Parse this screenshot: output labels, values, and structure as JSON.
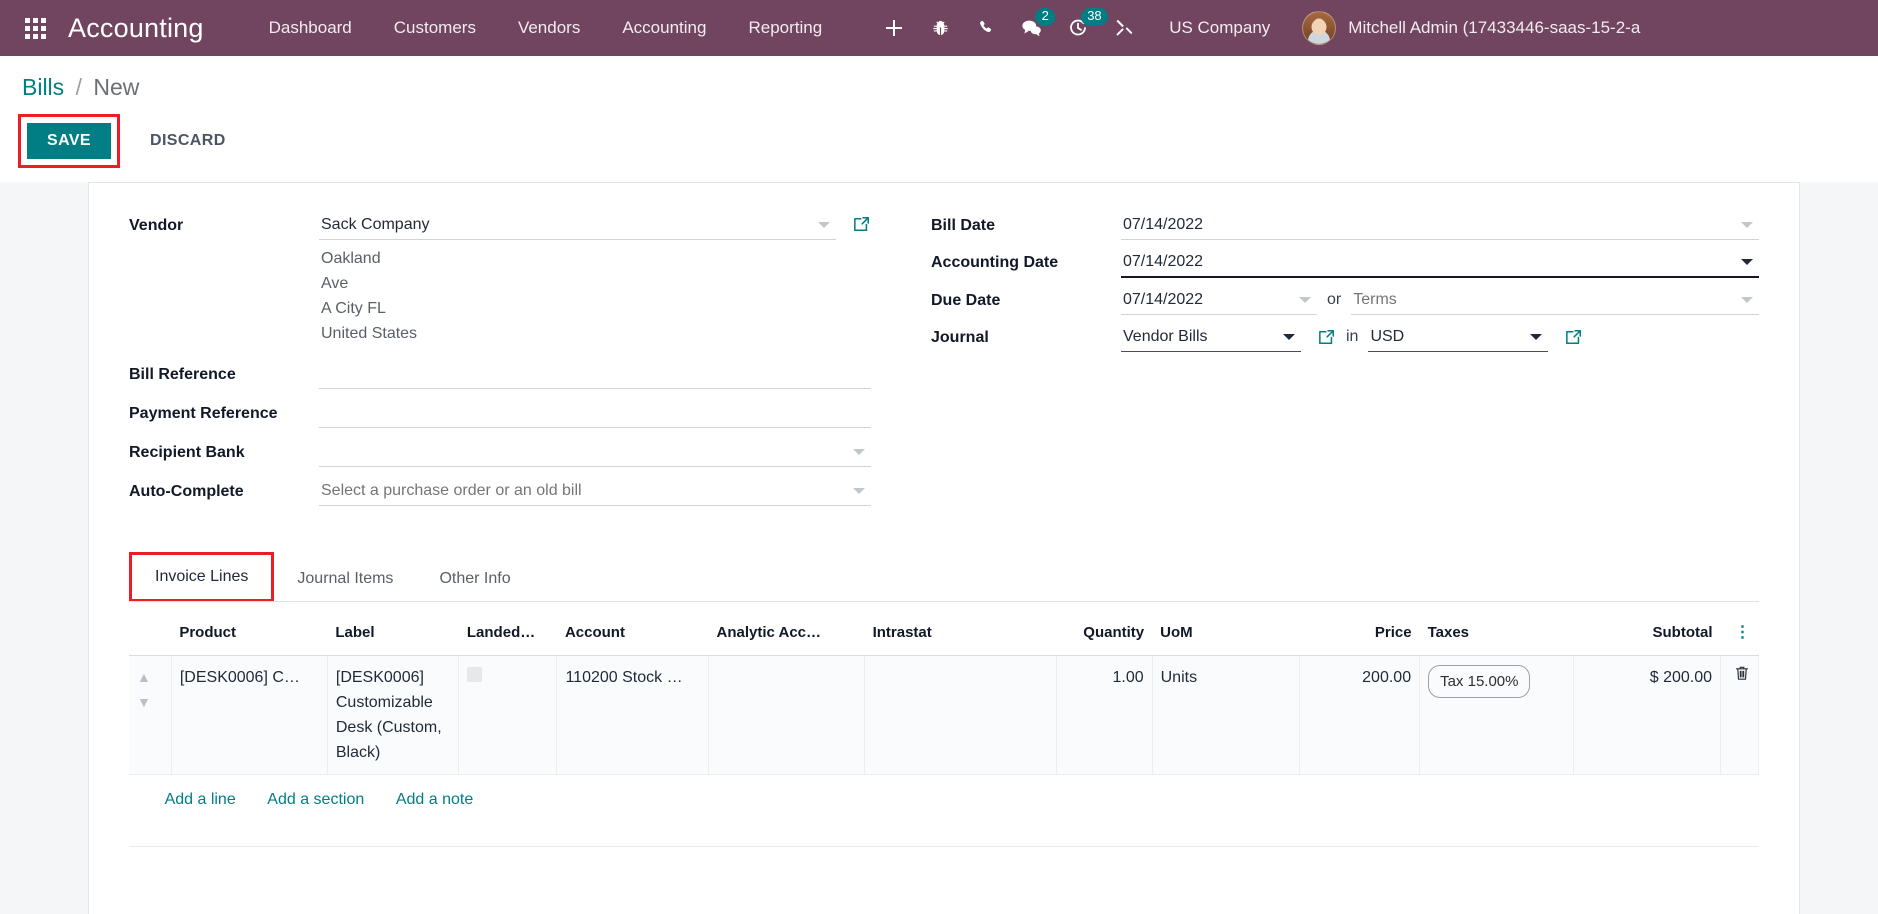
{
  "navbar": {
    "apps_icon": "apps-grid-icon",
    "brand": "Accounting",
    "menu": [
      {
        "label": "Dashboard"
      },
      {
        "label": "Customers"
      },
      {
        "label": "Vendors"
      },
      {
        "label": "Accounting"
      },
      {
        "label": "Reporting"
      }
    ],
    "icons": [
      {
        "name": "plus-icon",
        "badge": null
      },
      {
        "name": "bug-icon",
        "badge": null
      },
      {
        "name": "phone-icon",
        "badge": null
      },
      {
        "name": "messages-icon",
        "badge": "2"
      },
      {
        "name": "activity-clock-icon",
        "badge": "38"
      },
      {
        "name": "tools-icon",
        "badge": null
      }
    ],
    "messages_badge": "2",
    "activities_badge": "38",
    "company": "US Company",
    "user": "Mitchell Admin (17433446-saas-15-2-a",
    "brand_color": "#71445f",
    "accent_color": "#017e84"
  },
  "breadcrumb": {
    "root": "Bills",
    "separator": "/",
    "current": "New"
  },
  "actions": {
    "save": "SAVE",
    "discard": "DISCARD",
    "highlight_color": "#ee1c24"
  },
  "form": {
    "left": {
      "vendor_label": "Vendor",
      "vendor_value": "Sack Company",
      "vendor_address": [
        "Oakland",
        "Ave",
        "A City FL",
        "United States"
      ],
      "bill_reference_label": "Bill Reference",
      "bill_reference_value": "",
      "payment_reference_label": "Payment Reference",
      "payment_reference_value": "",
      "recipient_bank_label": "Recipient Bank",
      "recipient_bank_value": "",
      "autocomplete_label": "Auto-Complete",
      "autocomplete_placeholder": "Select a purchase order or an old bill"
    },
    "right": {
      "bill_date_label": "Bill Date",
      "bill_date_value": "07/14/2022",
      "accounting_date_label": "Accounting Date",
      "accounting_date_value": "07/14/2022",
      "due_date_label": "Due Date",
      "due_date_value": "07/14/2022",
      "or_word": "or",
      "terms_placeholder": "Terms",
      "journal_label": "Journal",
      "journal_value": "Vendor Bills",
      "in_word": "in",
      "currency_value": "USD"
    }
  },
  "tabs": [
    {
      "label": "Invoice Lines",
      "active": true,
      "highlighted": true
    },
    {
      "label": "Journal Items",
      "active": false,
      "highlighted": false
    },
    {
      "label": "Other Info",
      "active": false,
      "highlighted": false
    }
  ],
  "lines_table": {
    "headers": {
      "product": "Product",
      "label": "Label",
      "landed": "Landed…",
      "account": "Account",
      "analytic": "Analytic Acc…",
      "intrastat": "Intrastat",
      "quantity": "Quantity",
      "uom": "UoM",
      "price": "Price",
      "taxes": "Taxes",
      "subtotal": "Subtotal",
      "options": "options-icon"
    },
    "rows": [
      {
        "product": "[DESK0006] C…",
        "label": "[DESK0006] Customizable Desk (Custom, Black)",
        "landed": "",
        "account": "110200 Stock …",
        "analytic": "",
        "intrastat": "",
        "quantity": "1.00",
        "uom": "Units",
        "price": "200.00",
        "taxes": "Tax 15.00%",
        "subtotal": "$ 200.00",
        "delete_icon": "trash-icon"
      }
    ],
    "add_links": [
      {
        "label": "Add a line"
      },
      {
        "label": "Add a section"
      },
      {
        "label": "Add a note"
      }
    ]
  }
}
